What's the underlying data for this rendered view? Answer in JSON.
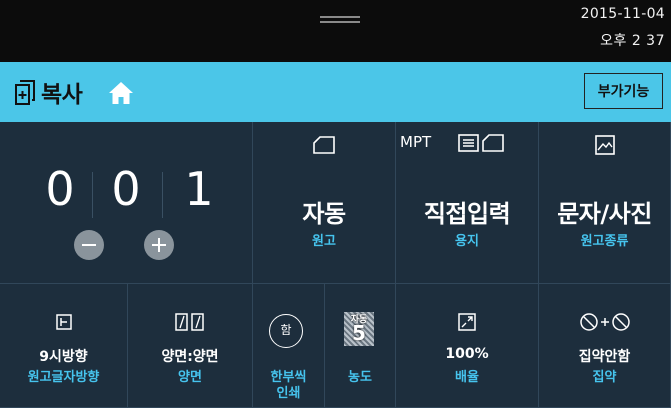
{
  "status": {
    "date": "2015-11-04",
    "time": "오후 2 37"
  },
  "header": {
    "title": "복사",
    "addon_label": "부가기능"
  },
  "counter": {
    "digits": [
      "0",
      "0",
      "1"
    ]
  },
  "top_tiles": [
    {
      "value": "자동",
      "label": "원고",
      "icon": "original-page-icon"
    },
    {
      "prefix": "MPT",
      "value": "직접입력",
      "label": "용지",
      "icon": "paper-tray-icon"
    },
    {
      "value": "문자/사진",
      "label": "원고종류",
      "icon": "image-icon"
    }
  ],
  "bottom_tiles": [
    {
      "value": "9시방향",
      "label": "원고글자방향",
      "icon": "orientation-icon"
    },
    {
      "value": "양면:양면",
      "label": "양면",
      "icon": "duplex-icon"
    },
    {
      "badge": "함",
      "label_line1": "한부씩",
      "label_line2": "인쇄",
      "icon": "collate-icon"
    },
    {
      "badge_top": "자동",
      "badge_value": "5",
      "label": "농도",
      "icon": "density-icon"
    },
    {
      "value": "100%",
      "label": "배율",
      "icon": "zoom-ratio-icon"
    },
    {
      "value": "집약안함",
      "label": "집약",
      "icon": "combine-icon"
    }
  ],
  "colors": {
    "accent": "#4bc6e8",
    "label": "#46c4ee",
    "panel": "#1d2e3d"
  }
}
